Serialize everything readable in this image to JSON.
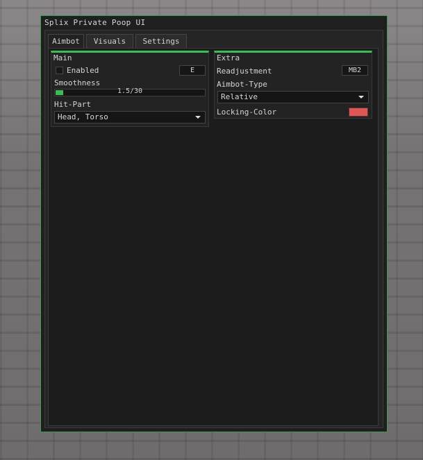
{
  "window": {
    "title": "Splix Private Poop UI"
  },
  "tabs": [
    {
      "label": "Aimbot",
      "active": true
    },
    {
      "label": "Visuals",
      "active": false
    },
    {
      "label": "Settings",
      "active": false
    }
  ],
  "main": {
    "header": "Main",
    "enabled": {
      "label": "Enabled",
      "checked": false,
      "keybind": "E"
    },
    "smoothness": {
      "label": "Smoothness",
      "value_text": "1.5/30",
      "value": 1.5,
      "max": 30
    },
    "hit_part": {
      "label": "Hit-Part",
      "selected": "Head, Torso"
    }
  },
  "extra": {
    "header": "Extra",
    "readjustment": {
      "label": "Readjustment",
      "keybind": "MB2"
    },
    "aimbot_type": {
      "label": "Aimbot-Type",
      "selected": "Relative"
    },
    "locking_color": {
      "label": "Locking-Color",
      "color": "#e05555"
    }
  },
  "colors": {
    "accent": "#34c152",
    "window_border": "#3a9e4d"
  }
}
